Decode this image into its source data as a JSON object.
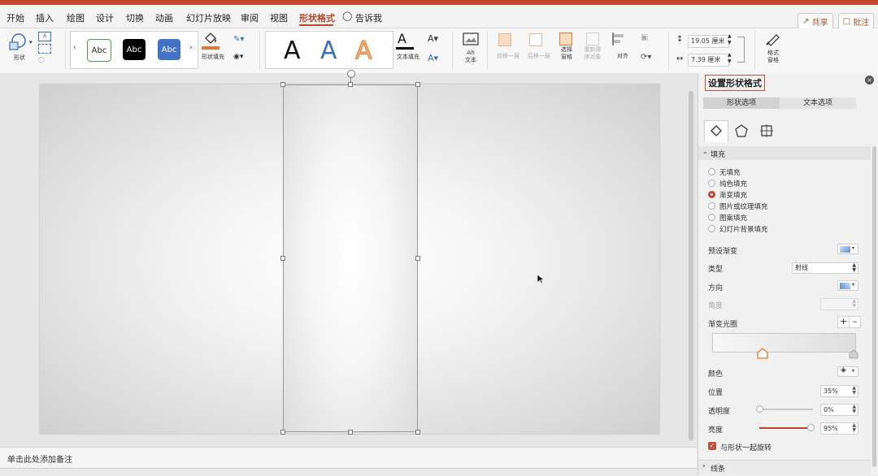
{
  "menu": {
    "tabs": [
      "开始",
      "插入",
      "绘图",
      "设计",
      "切换",
      "动画",
      "幻灯片放映",
      "审阅",
      "视图",
      "形状格式",
      "告诉我"
    ],
    "active_tab": "形状格式",
    "share_label": "共享",
    "comment_label": "批注"
  },
  "ribbon": {
    "shape_label": "形状",
    "style_samples": [
      "Abc",
      "Abc",
      "Abc"
    ],
    "shape_fill_label": "形状填充",
    "wordart_samples": [
      "A",
      "A",
      "A"
    ],
    "text_fill_label": "文本填充",
    "alt_text_label": "Alt\n文本",
    "bring_forward_label": "前移一层",
    "send_backward_label": "后移一层",
    "selection_pane_label": "选择\n窗格",
    "reorder_label": "重新排\n序对象",
    "align_label": "对齐",
    "height_value": "19.05 厘米",
    "width_value": "7.39 厘米",
    "format_pane_label": "格式\n窗格"
  },
  "notes": {
    "placeholder": "单击此处添加备注"
  },
  "panel": {
    "title": "设置形状格式",
    "tab_shape": "形状选项",
    "tab_text": "文本选项",
    "fill_section": "填充",
    "fill_options": [
      "无填充",
      "纯色填充",
      "渐变填充",
      "图片或纹理填充",
      "图案填充",
      "幻灯片背景填充"
    ],
    "selected_fill": "渐变填充",
    "preset_gradient_label": "预设渐变",
    "type_label": "类型",
    "type_value": "射线",
    "direction_label": "方向",
    "angle_label": "角度",
    "gradient_stops_label": "渐变光圈",
    "color_label": "颜色",
    "position_label": "位置",
    "position_value": "35%",
    "transparency_label": "透明度",
    "transparency_value": "0%",
    "transparency_level": 0.0,
    "brightness_label": "亮度",
    "brightness_value": "95%",
    "brightness_level": 0.95,
    "rotate_with_shape_label": "与形状一起旋转",
    "rotate_with_shape_checked": true,
    "line_section": "线条"
  },
  "colors": {
    "accent": "#b7472a",
    "title_bar": "#c8462e",
    "checkbox": "#c0503a"
  }
}
